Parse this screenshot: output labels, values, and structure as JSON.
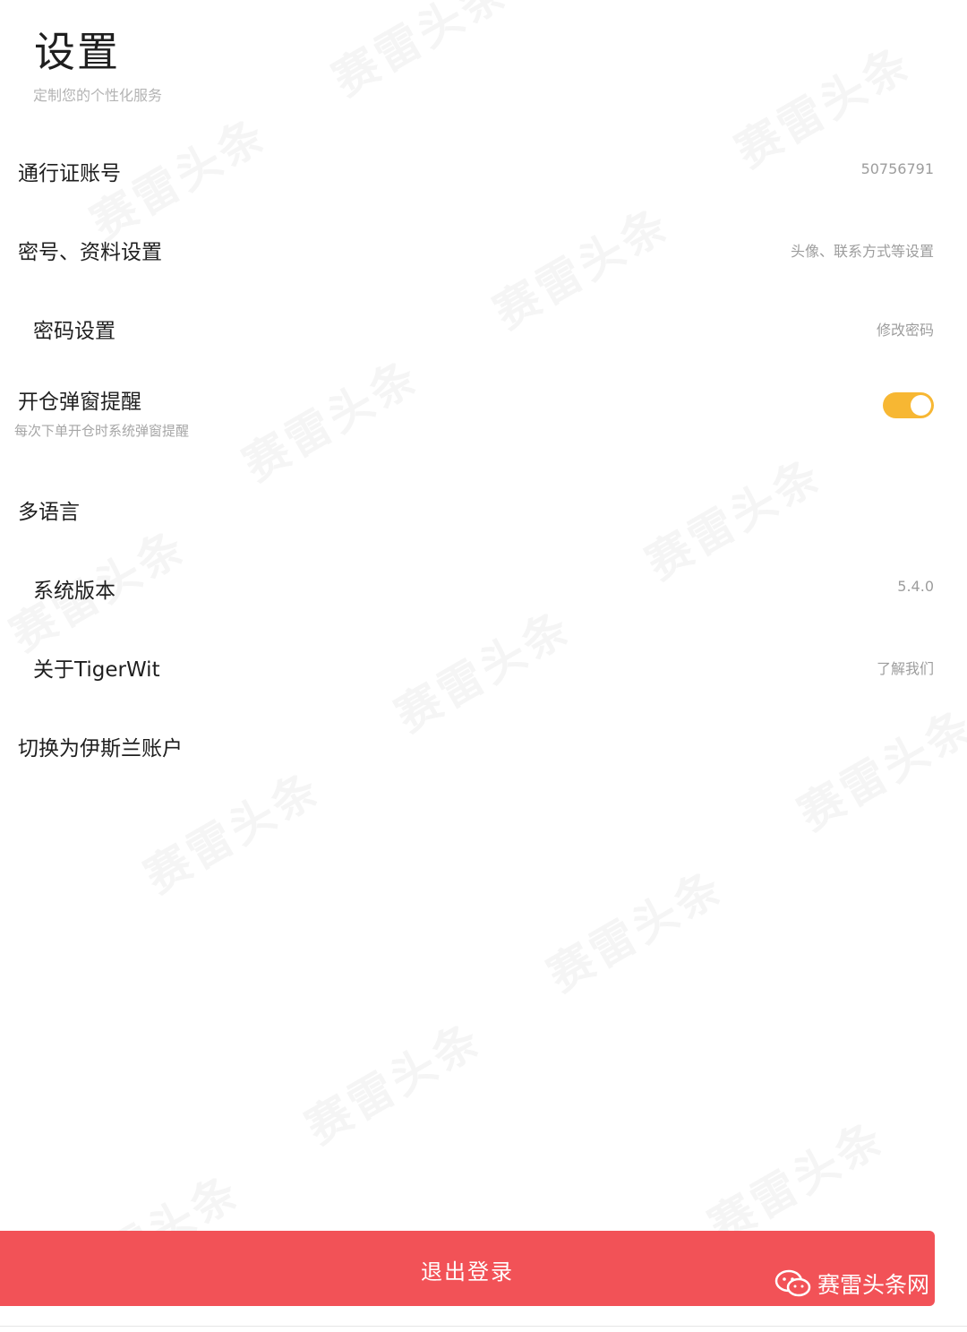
{
  "header": {
    "title": "设置",
    "subtitle": "定制您的个性化服务"
  },
  "settings": {
    "passport": {
      "label": "通行证账号",
      "value": "50756791"
    },
    "profile": {
      "label": "密号、资料设置",
      "value": "头像、联系方式等设置"
    },
    "password": {
      "label": "密码设置",
      "value": "修改密码"
    },
    "open_alert": {
      "label": "开仓弹窗提醒",
      "sub": "每次下单开仓时系统弹窗提醒",
      "enabled": true
    },
    "language": {
      "label": "多语言"
    },
    "version": {
      "label": "系统版本",
      "value": "5.4.0"
    },
    "about": {
      "label": "关于TigerWit",
      "value": "了解我们"
    },
    "islamic": {
      "label": "切换为伊斯兰账户"
    }
  },
  "footer": {
    "logout_label": "退出登录",
    "watermark_label": "赛雷头条网"
  },
  "watermark": {
    "text": "赛雷头条"
  },
  "colors": {
    "accent": "#f7b733",
    "danger": "#f25257"
  }
}
